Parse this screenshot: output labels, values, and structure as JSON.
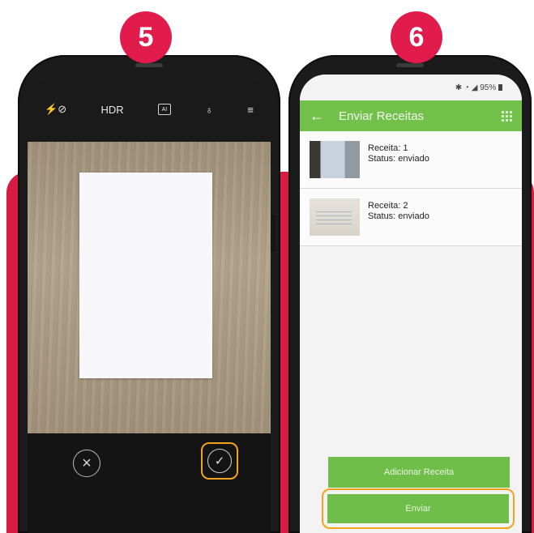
{
  "steps": {
    "left": "5",
    "right": "6"
  },
  "camera": {
    "toolbar": {
      "flash": "⚡⊘",
      "hdr": "HDR",
      "ai": "AI",
      "filters": "♁",
      "menu": "≡"
    },
    "cancel_icon": "×",
    "confirm_icon": "✓"
  },
  "app": {
    "status": {
      "icons": "✱ ◔ ◢",
      "battery": "95%"
    },
    "title": "Enviar Receitas",
    "back_icon": "←",
    "receipts": [
      {
        "title": "Receita: 1",
        "status": "Status: enviado"
      },
      {
        "title": "Receita: 2",
        "status": "Status: enviado"
      }
    ],
    "add_button": "Adicionar Receita",
    "send_button": "Enviar"
  },
  "colors": {
    "badge": "#e11b4c",
    "background_accent": "#d81b45",
    "app_green": "#72c14b",
    "highlight": "#f4a21b"
  }
}
